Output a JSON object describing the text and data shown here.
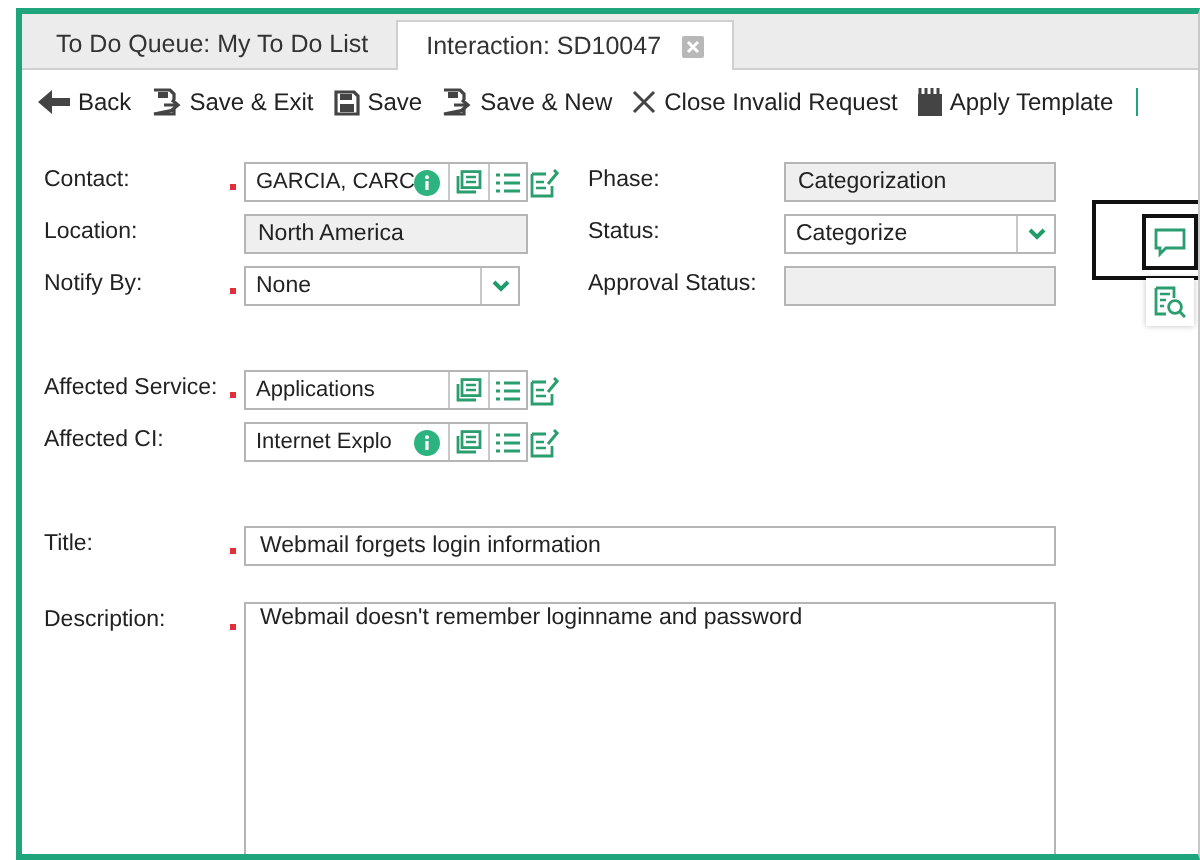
{
  "tabs": [
    {
      "label": "To Do Queue: My To Do List",
      "selected": false,
      "closable": false
    },
    {
      "label": "Interaction: SD10047",
      "selected": true,
      "closable": true
    }
  ],
  "toolbar": [
    {
      "label": "Back",
      "kind": "back"
    },
    {
      "label": "Save & Exit",
      "kind": "save-exit"
    },
    {
      "label": "Save",
      "kind": "save"
    },
    {
      "label": "Save & New",
      "kind": "save-new"
    },
    {
      "label": "Close Invalid Request",
      "kind": "close"
    },
    {
      "label": "Apply Template",
      "kind": "template"
    }
  ],
  "sections": [
    [
      [
        {
          "label": "Contact:",
          "kind": "lookup",
          "required": true,
          "value": "GARCIA, CARC",
          "info": true
        },
        {
          "label": "Phase:",
          "kind": "readonly",
          "required": false,
          "value": "Categorization"
        }
      ],
      [
        {
          "label": "Location:",
          "kind": "readonly",
          "required": false,
          "value": "North America"
        },
        {
          "label": "Status:",
          "kind": "select",
          "required": false,
          "value": "Categorize"
        }
      ],
      [
        {
          "label": "Notify By:",
          "kind": "select",
          "required": true,
          "value": "None"
        },
        {
          "label": "Approval Status:",
          "kind": "readonly",
          "required": false
        }
      ]
    ],
    [
      [
        {
          "label": "Affected Service:",
          "kind": "lookup",
          "required": true,
          "value": "Applications",
          "info": false
        }
      ],
      [
        {
          "label": "Affected CI:",
          "kind": "lookup",
          "required": false,
          "value": "Internet Explo",
          "info": true
        }
      ]
    ],
    [
      [
        {
          "label": "Title:",
          "kind": "text",
          "required": true,
          "value": "Webmail forgets login information"
        }
      ]
    ],
    [
      [
        {
          "label": "Description:",
          "kind": "textarea",
          "required": true,
          "value": "Webmail doesn't remember loginname and password"
        }
      ]
    ]
  ],
  "side_tools": [
    {
      "kind": "chat",
      "highlighted": true
    },
    {
      "kind": "search-doc",
      "highlighted": false
    }
  ]
}
